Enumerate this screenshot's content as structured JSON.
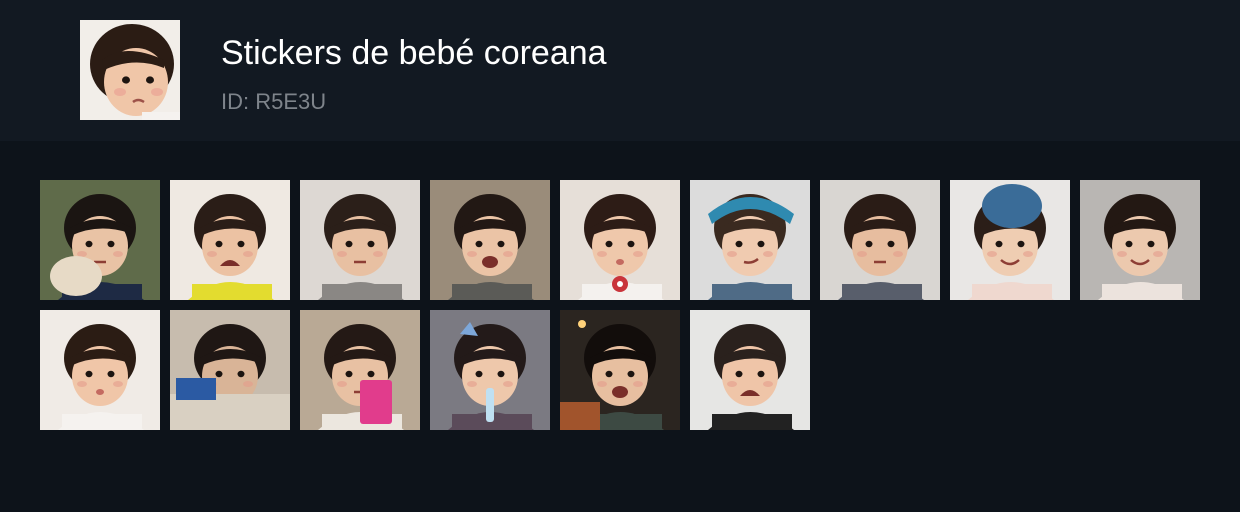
{
  "pack": {
    "title": "Stickers de bebé coreana",
    "id_label": "ID: R5E3U",
    "thumbnail_icon": "crying-baby-face"
  },
  "stickers": [
    {
      "name": "sticker-hugging-plush",
      "bg": "#5f6b4a",
      "hair": "#1b1512",
      "skin": "#e9c3a5",
      "shirt": "#1e2a44",
      "mouth": "flat",
      "prop": "plush"
    },
    {
      "name": "sticker-crying-yellow-shirt",
      "bg": "#efe9e2",
      "hair": "#2a1d17",
      "skin": "#ecc2a3",
      "shirt": "#e3dc2f",
      "mouth": "cry",
      "prop": "none"
    },
    {
      "name": "sticker-pointing-gray-shirt",
      "bg": "#ddd8d3",
      "hair": "#2b1f19",
      "skin": "#e8c0a2",
      "shirt": "#8a8784",
      "mouth": "flat",
      "prop": "none"
    },
    {
      "name": "sticker-laughing-gray",
      "bg": "#9a8c7a",
      "hair": "#221814",
      "skin": "#ebc4a6",
      "shirt": "#5b5b57",
      "mouth": "open",
      "prop": "none"
    },
    {
      "name": "sticker-side-eye-pacifier",
      "bg": "#e6dfd8",
      "hair": "#2d1c16",
      "skin": "#efc8ab",
      "shirt": "#f4f1ee",
      "mouth": "pout",
      "prop": "pacifier"
    },
    {
      "name": "sticker-blue-headband",
      "bg": "#dcdcdc",
      "hair": "#3a2a20",
      "skin": "#f0cbb0",
      "shirt": "#4f6b86",
      "mouth": "smirk",
      "prop": "headband"
    },
    {
      "name": "sticker-finger-on-cheek",
      "bg": "#d9d6d2",
      "hair": "#2a1c16",
      "skin": "#e7bd9f",
      "shirt": "#585e6b",
      "mouth": "flat",
      "prop": "none"
    },
    {
      "name": "sticker-blue-hat-smiling",
      "bg": "#e9e7e5",
      "hair": "#2b1e18",
      "skin": "#efcdb2",
      "shirt": "#efd8cf",
      "mouth": "smile",
      "prop": "hat"
    },
    {
      "name": "sticker-arms-out-kitchen",
      "bg": "#b9b6b3",
      "hair": "#231813",
      "skin": "#ecc9ae",
      "shirt": "#ece3dd",
      "mouth": "smile",
      "prop": "none"
    },
    {
      "name": "sticker-sad-closeup",
      "bg": "#f0ebe6",
      "hair": "#2b1c14",
      "skin": "#f0c6a8",
      "shirt": "#f5f2ef",
      "mouth": "pout",
      "prop": "none"
    },
    {
      "name": "sticker-hiding-on-couch",
      "bg": "#c7bcae",
      "hair": "#1f1714",
      "skin": "#d9b497",
      "shirt": "#d8cfc2",
      "mouth": "none",
      "prop": "couch"
    },
    {
      "name": "sticker-pink-bag",
      "bg": "#b9a995",
      "hair": "#241915",
      "skin": "#e8c1a3",
      "shirt": "#ece7df",
      "mouth": "flat",
      "prop": "bag"
    },
    {
      "name": "sticker-drinking-bottle",
      "bg": "#7b7a82",
      "hair": "#231a19",
      "skin": "#eec8ab",
      "shirt": "#5b4b5a",
      "mouth": "bottle",
      "prop": "clip"
    },
    {
      "name": "sticker-night-street",
      "bg": "#2b2520",
      "hair": "#120d0b",
      "skin": "#e7bfa0",
      "shirt": "#3d4a43",
      "mouth": "open",
      "prop": "night"
    },
    {
      "name": "sticker-crying-wet-hair",
      "bg": "#e6e6e4",
      "hair": "#2a211d",
      "skin": "#efc5a8",
      "shirt": "#222222",
      "mouth": "cry",
      "prop": "none"
    }
  ]
}
